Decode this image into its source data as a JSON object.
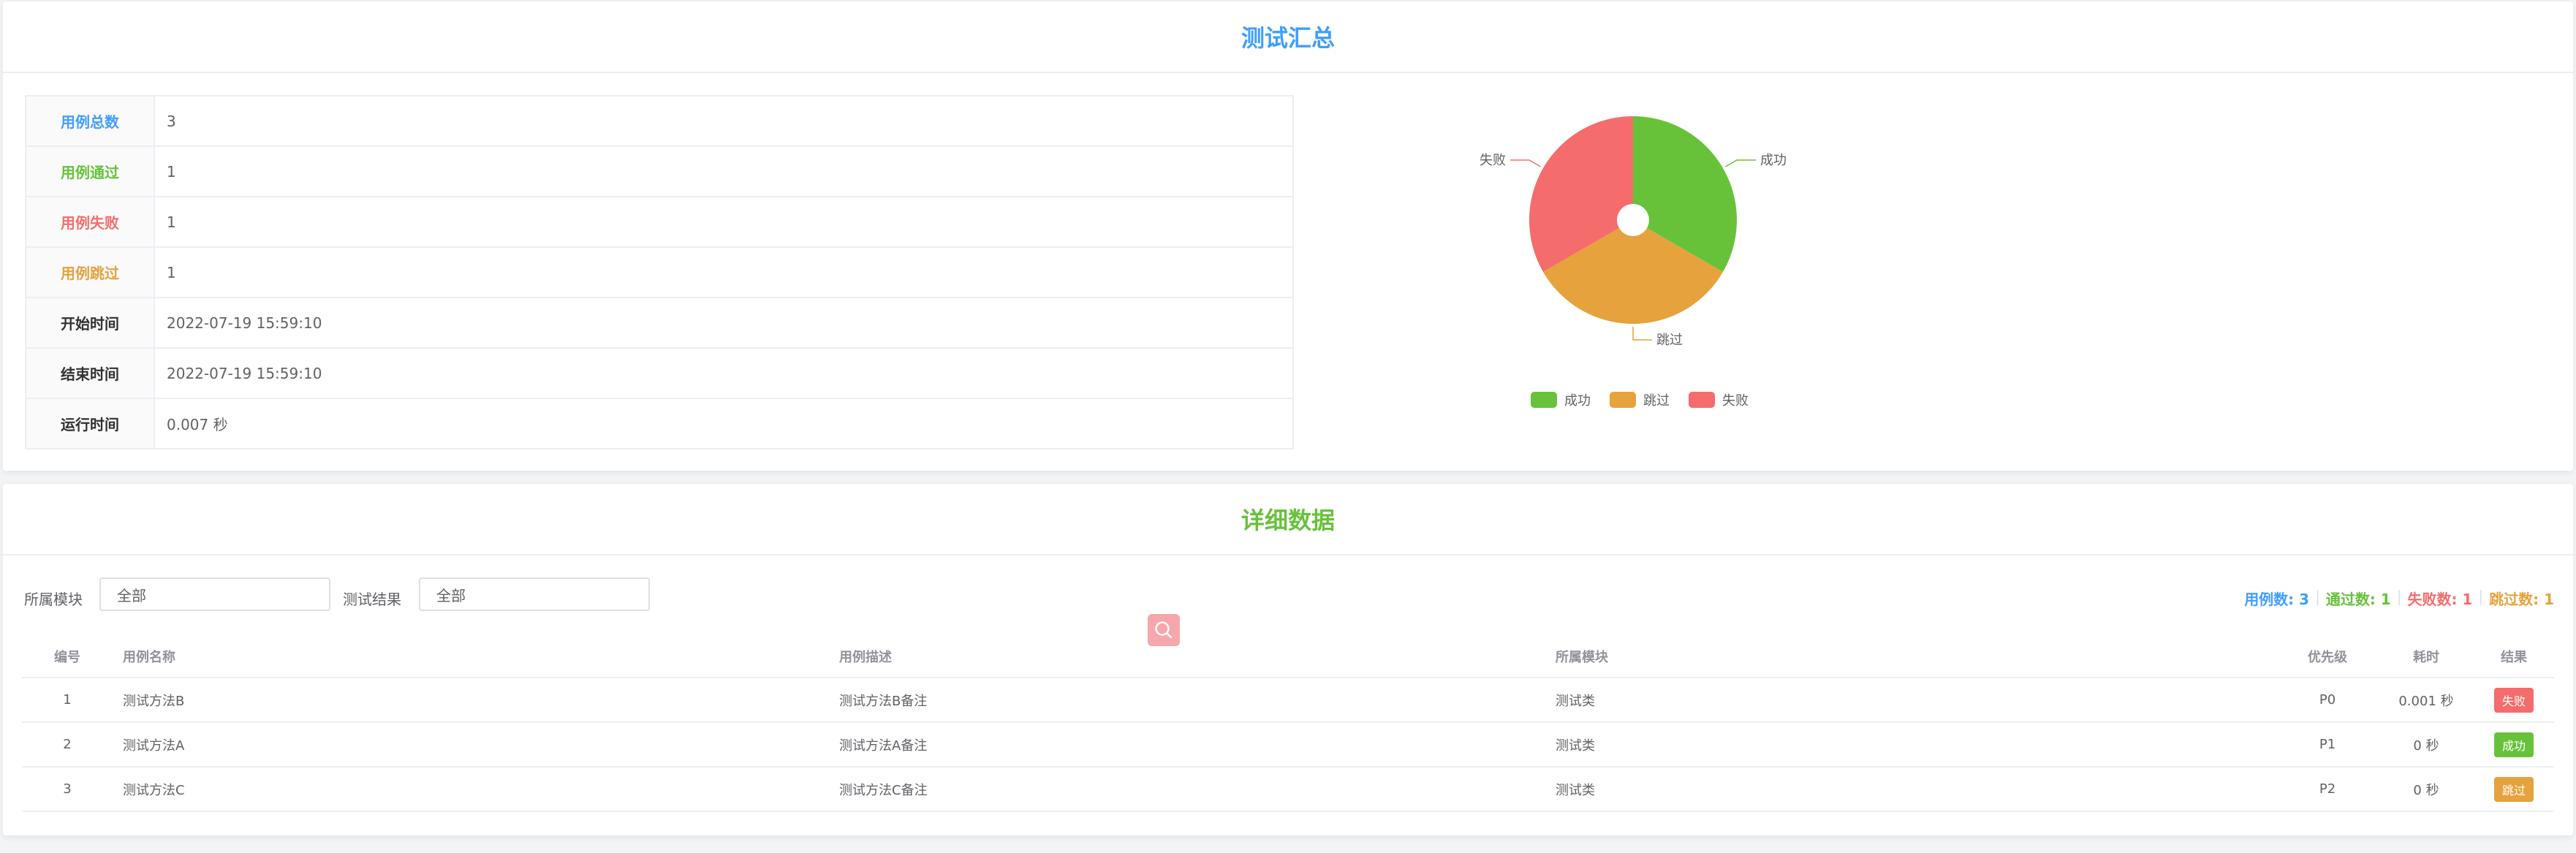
{
  "summary": {
    "title": "测试汇总",
    "rows": [
      {
        "label": "用例总数",
        "value": "3",
        "color": "#409eff"
      },
      {
        "label": "用例通过",
        "value": "1",
        "color": "#67c23a"
      },
      {
        "label": "用例失败",
        "value": "1",
        "color": "#f56c6c"
      },
      {
        "label": "用例跳过",
        "value": "1",
        "color": "#e6a23c"
      },
      {
        "label": "开始时间",
        "value": "2022-07-19 15:59:10",
        "color": "#303133"
      },
      {
        "label": "结束时间",
        "value": "2022-07-19 15:59:10",
        "color": "#303133"
      },
      {
        "label": "运行时间",
        "value": "0.007 秒",
        "color": "#303133"
      }
    ]
  },
  "chart_data": {
    "type": "pie",
    "title": "",
    "slices": [
      {
        "name": "成功",
        "value": 1,
        "color": "#67c23a"
      },
      {
        "name": "跳过",
        "value": 1,
        "color": "#e6a23c"
      },
      {
        "name": "失败",
        "value": 1,
        "color": "#f56c6c"
      }
    ],
    "legend_position": "bottom"
  },
  "detail": {
    "title": "详细数据",
    "filters": {
      "module_label": "所属模块",
      "module_value": "全部",
      "result_label": "测试结果",
      "result_value": "全部"
    },
    "stats": {
      "total": "用例数: 3",
      "pass": "通过数: 1",
      "fail": "失败数: 1",
      "skip": "跳过数: 1"
    },
    "columns": [
      "编号",
      "用例名称",
      "用例描述",
      "所属模块",
      "优先级",
      "耗时",
      "结果"
    ],
    "rows": [
      {
        "no": "1",
        "name": "测试方法B",
        "desc": "测试方法B备注",
        "module": "测试类",
        "priority": "P0",
        "time": "0.001 秒",
        "result": "失败",
        "result_color": "#f56c6c"
      },
      {
        "no": "2",
        "name": "测试方法A",
        "desc": "测试方法A备注",
        "module": "测试类",
        "priority": "P1",
        "time": "0 秒",
        "result": "成功",
        "result_color": "#67c23a"
      },
      {
        "no": "3",
        "name": "测试方法C",
        "desc": "测试方法C备注",
        "module": "测试类",
        "priority": "P2",
        "time": "0 秒",
        "result": "跳过",
        "result_color": "#e6a23c"
      }
    ]
  },
  "colors": {
    "primary": "#409eff",
    "success": "#67c23a",
    "danger": "#f56c6c",
    "warning": "#e6a23c",
    "search_button": "#f6a7ac"
  },
  "icons": {
    "search": "search-icon"
  }
}
